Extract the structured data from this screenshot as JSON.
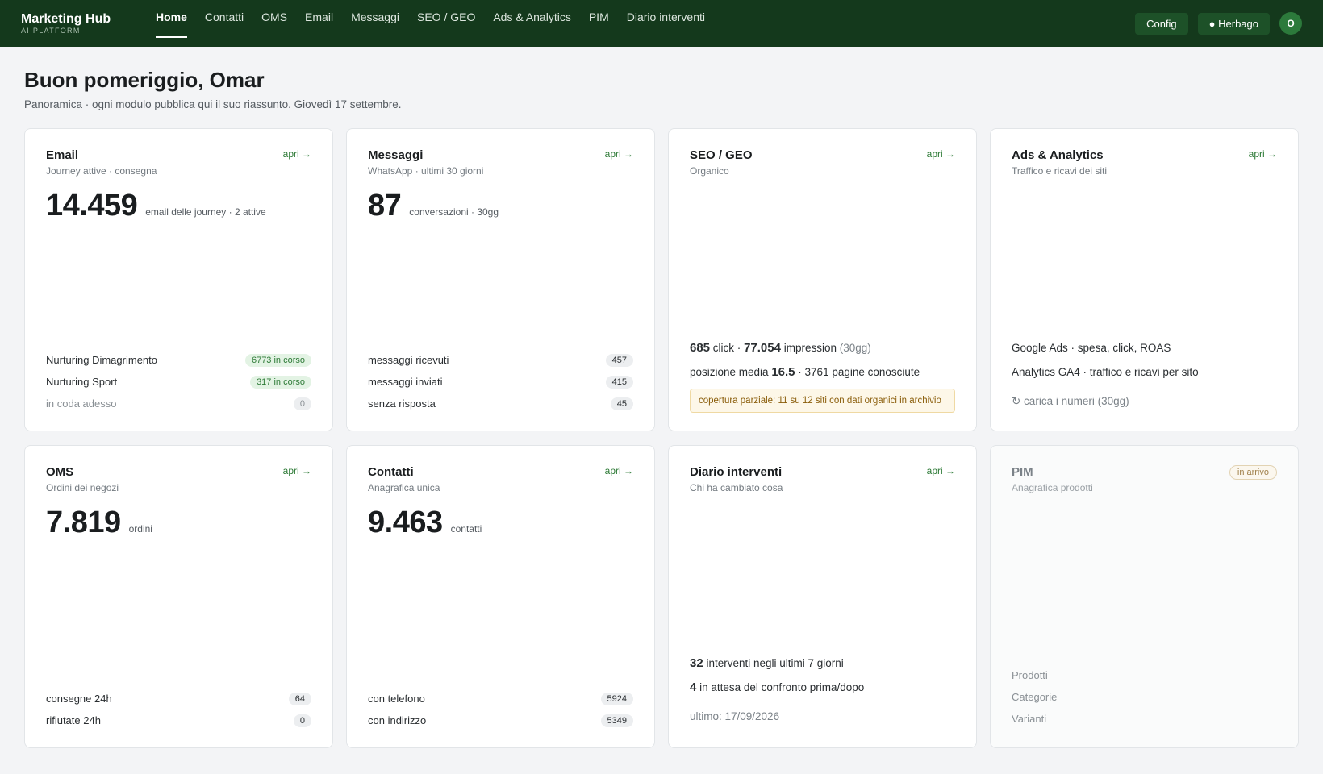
{
  "brand": {
    "name": "Marketing Hub",
    "sub": "AI PLATFORM"
  },
  "nav": [
    "Home",
    "Contatti",
    "OMS",
    "Email",
    "Messaggi",
    "SEO / GEO",
    "Ads & Analytics",
    "PIM",
    "Diario interventi"
  ],
  "active_nav": "Home",
  "top_right": {
    "config": "Config",
    "site": "● Herbago",
    "avatar": "O"
  },
  "page": {
    "title": "Buon pomeriggio, Omar",
    "subtitle": "Panoramica · ogni modulo pubblica qui il suo riassunto. Giovedì 17 settembre."
  },
  "open_label": "apri →",
  "cards": {
    "email": {
      "title": "Email",
      "sub": "Journey attive · consegna",
      "kpi": "14.459",
      "kpi_label": "email delle journey · 2 attive",
      "rows": [
        {
          "label": "Nurturing Dimagrimento",
          "value": "6773 in corso"
        },
        {
          "label": "Nurturing Sport",
          "value": "317 in corso"
        },
        {
          "label": "in coda adesso",
          "value": "0"
        }
      ]
    },
    "messaggi": {
      "title": "Messaggi",
      "sub": "WhatsApp · ultimi 30 giorni",
      "kpi": "87",
      "kpi_label": "conversazioni · 30gg",
      "rows": [
        {
          "label": "messaggi ricevuti",
          "value": "457"
        },
        {
          "label": "messaggi inviati",
          "value": "415"
        },
        {
          "label": "senza risposta",
          "value": "45"
        }
      ]
    },
    "seo": {
      "title": "SEO / GEO",
      "sub": "Organico",
      "clicks": "685",
      "clicks_label": "click ·",
      "impressions": "77.054",
      "impressions_label": "impression",
      "period": "(30gg)",
      "position_label": "posizione media",
      "position": "16.5",
      "pages": "· 3761 pagine conosciute",
      "warning": "copertura parziale: 11 su 12 siti con dati organici in archivio"
    },
    "ads": {
      "title": "Ads & Analytics",
      "sub": "Traffico e ricavi dei siti",
      "line1": "Google Ads · spesa, click, ROAS",
      "line2": "Analytics GA4 · traffico e ricavi per sito",
      "load": "↻ carica i numeri (30gg)"
    },
    "oms": {
      "title": "OMS",
      "sub": "Ordini dei negozi",
      "kpi": "7.819",
      "kpi_label": "ordini",
      "rows": [
        {
          "label": "consegne 24h",
          "value": "64"
        },
        {
          "label": "rifiutate 24h",
          "value": "0"
        }
      ]
    },
    "contatti": {
      "title": "Contatti",
      "sub": "Anagrafica unica",
      "kpi": "9.463",
      "kpi_label": "contatti",
      "rows": [
        {
          "label": "con telefono",
          "value": "5924"
        },
        {
          "label": "con indirizzo",
          "value": "5349"
        }
      ]
    },
    "diario": {
      "title": "Diario interventi",
      "sub": "Chi ha cambiato cosa",
      "count": "32",
      "count_label": "interventi negli ultimi 7 giorni",
      "pending": "4",
      "pending_label": "in attesa del confronto prima/dopo",
      "last": "ultimo: 17/09/2026"
    },
    "pim": {
      "title": "PIM",
      "sub": "Anagrafica prodotti",
      "badge": "in arrivo",
      "items": [
        "Prodotti",
        "Categorie",
        "Varianti"
      ]
    }
  }
}
